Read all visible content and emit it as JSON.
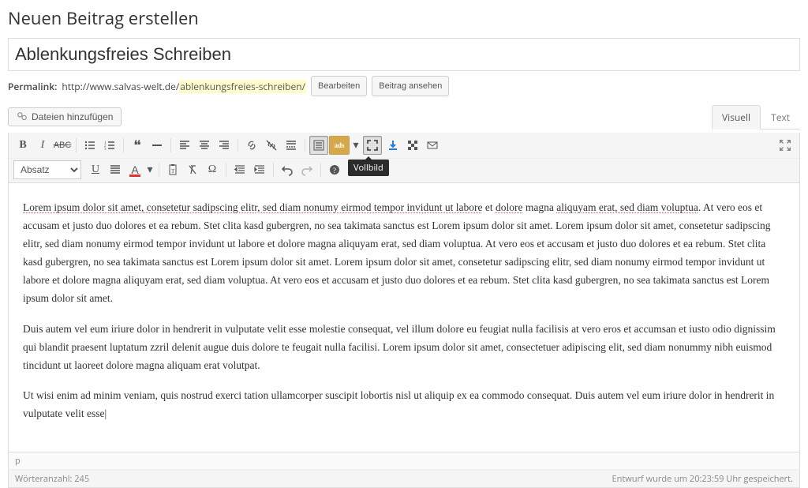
{
  "page_heading": "Neuen Beitrag erstellen",
  "post_title": "Ablenkungsfreies Schreiben",
  "permalink": {
    "label": "Permalink:",
    "base": "http://www.salvas-welt.de/",
    "slug": "ablenkungsfreies-schreiben/",
    "edit_btn": "Bearbeiten",
    "view_btn": "Beitrag ansehen"
  },
  "media_button": "Dateien hinzufügen",
  "tabs": {
    "visual": "Visuell",
    "text": "Text"
  },
  "toolbar": {
    "format_dropdown": "Absatz",
    "fullscreen_tooltip": "Vollbild",
    "caret": "▾"
  },
  "content": {
    "p1_spelled": "Lorem ipsum dolor sit amet, consetetur sadipscing elitr, sed diam nonumy eirmod tempor invidunt ut labore",
    "p1_mid1": " et ",
    "p1_sp2": "dolore",
    "p1_mid2": " magna ",
    "p1_sp3": "aliquyam erat, sed diam voluptua",
    "p1_rest": ". At vero eos et accusam et justo duo dolores et ea rebum. Stet clita kasd gubergren, no sea takimata sanctus est Lorem ipsum dolor sit amet. Lorem ipsum dolor sit amet, consetetur sadipscing elitr, sed diam nonumy eirmod tempor invidunt ut labore et dolore magna aliquyam erat, sed diam voluptua. At vero eos et accusam et justo duo dolores et ea rebum. Stet clita kasd gubergren, no sea takimata sanctus est Lorem ipsum dolor sit amet. Lorem ipsum dolor sit amet, consetetur sadipscing elitr, sed diam nonumy eirmod tempor invidunt ut labore et dolore magna aliquyam erat, sed diam voluptua. At vero eos et accusam et justo duo dolores et ea rebum. Stet clita kasd gubergren, no sea takimata sanctus est Lorem ipsum dolor sit amet.",
    "p2": "Duis autem vel eum iriure dolor in hendrerit in vulputate velit esse molestie consequat, vel illum dolore eu feugiat nulla facilisis at vero eros et accumsan et iusto odio dignissim qui blandit praesent luptatum zzril delenit augue duis dolore te feugait nulla facilisi. Lorem ipsum dolor sit amet, consectetuer adipiscing elit, sed diam nonummy nibh euismod tincidunt ut laoreet dolore magna aliquam erat volutpat.",
    "p3": "Ut wisi enim ad minim veniam, quis nostrud exerci tation ullamcorper suscipit lobortis nisl ut aliquip ex ea commodo consequat. Duis autem vel eum iriure dolor in hendrerit in vulputate velit esse"
  },
  "path_indicator": "p",
  "footer": {
    "word_count_label": "Wörteranzahl:",
    "word_count": "245",
    "save_status": "Entwurf wurde um 20:23:59 Uhr gespeichert."
  }
}
